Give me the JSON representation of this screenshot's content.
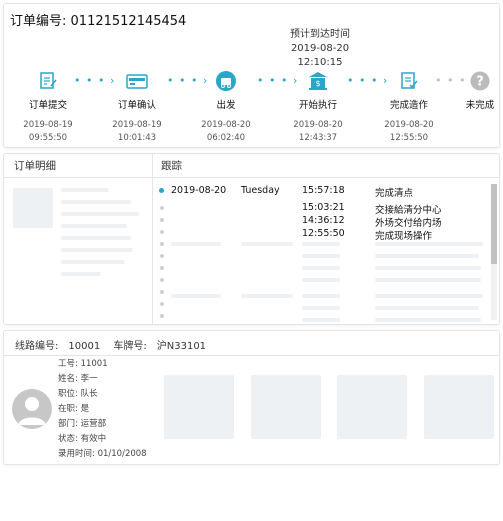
{
  "order": {
    "title_prefix": "订单编号:",
    "number": "01121512145454"
  },
  "eta": {
    "label": "预计到达时间",
    "date": "2019-08-20",
    "time": "12:10:15"
  },
  "steps": [
    {
      "label": "订单提交",
      "date": "2019-08-19",
      "time": "09:55:50",
      "icon": "edit-doc-icon"
    },
    {
      "label": "订单确认",
      "date": "2019-08-19",
      "time": "10:01:43",
      "icon": "card-icon"
    },
    {
      "label": "出发",
      "date": "2019-08-20",
      "time": "06:02:40",
      "icon": "depart-icon"
    },
    {
      "label": "开始执行",
      "date": "2019-08-20",
      "time": "12:43:37",
      "icon": "bank-icon"
    },
    {
      "label": "完成造作",
      "date": "2019-08-20",
      "time": "12:55:50",
      "icon": "checklist-icon"
    },
    {
      "label": "未完成",
      "icon": "question-icon"
    }
  ],
  "colors": {
    "accent": "#2aa6c6",
    "muted": "#bbbbbb",
    "skeleton": "#eef1f4"
  },
  "detail": {
    "left_title": "订单明细",
    "right_title": "跟踪"
  },
  "tracking": [
    {
      "date": "2019-08-20",
      "weekday": "Tuesday",
      "time": "15:57:18",
      "event": "完成清点"
    },
    {
      "time": "15:03:21",
      "event": "交接給清分中心"
    },
    {
      "time": "14:36:12",
      "event": "外场交付给内场"
    },
    {
      "time": "12:55:50",
      "event": "完成现场操作"
    }
  ],
  "route": {
    "line_label": "线路编号:",
    "line_value": "10001",
    "plate_label": "车牌号:",
    "plate_value": "沪N33101"
  },
  "driver": {
    "fields": [
      {
        "label": "工号:",
        "value": "11001"
      },
      {
        "label": "姓名:",
        "value": "李一"
      },
      {
        "label": "职位:",
        "value": "队长"
      },
      {
        "label": "在职:",
        "value": "是"
      },
      {
        "label": "部门:",
        "value": "运营部"
      },
      {
        "label": "状态:",
        "value": "有效中"
      },
      {
        "label": "录用时间:",
        "value": "01/10/2008"
      }
    ]
  }
}
